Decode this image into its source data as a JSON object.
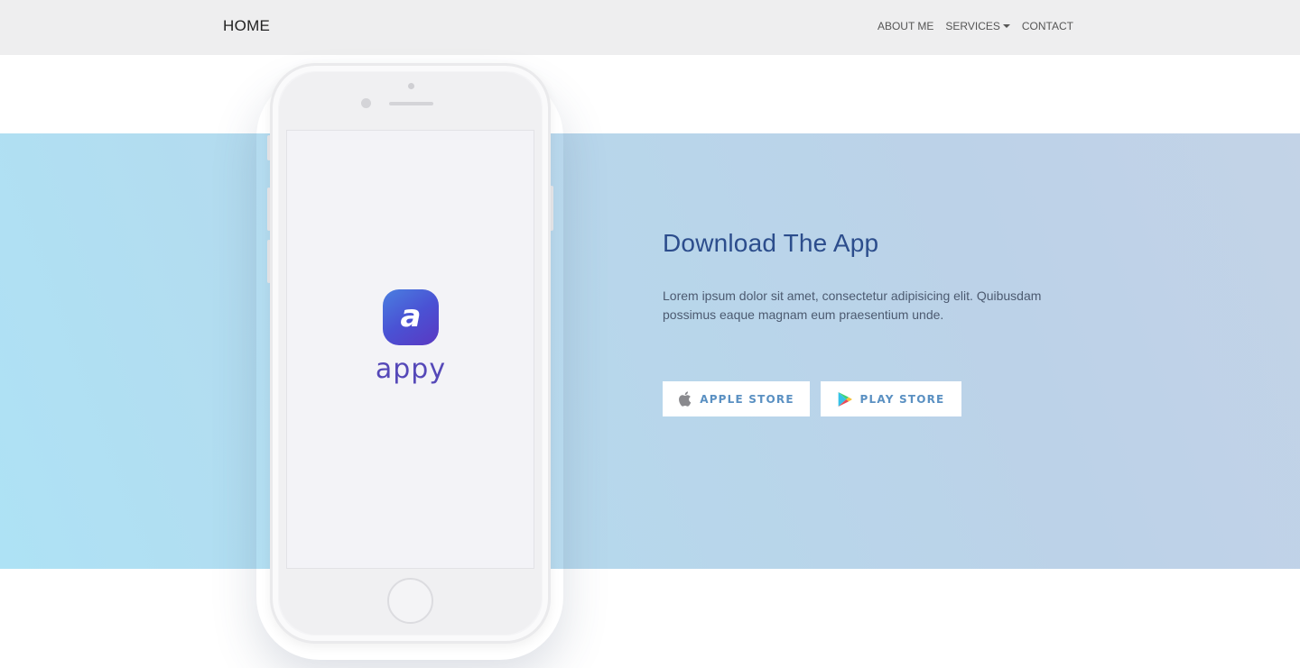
{
  "navbar": {
    "brand": "HOME",
    "links": [
      {
        "label": "ABOUT ME"
      },
      {
        "label": "SERVICES"
      },
      {
        "label": "CONTACT"
      }
    ]
  },
  "phone": {
    "app_icon_letter": "a",
    "app_name": "appy"
  },
  "hero": {
    "title": "Download The App",
    "description": "Lorem ipsum dolor sit amet, consectetur adipisicing elit. Quibusdam possimus eaque magnam eum praesentium unde.",
    "buttons": {
      "apple": {
        "label": "APPLE STORE",
        "icon": "apple-icon"
      },
      "play": {
        "label": "PLAY STORE",
        "icon": "play-store-icon"
      }
    }
  },
  "colors": {
    "accent_text": "#2c4d8c",
    "button_text": "#5a90c2",
    "app_icon": "#4a52d4",
    "hero_background": "#b6d8ec"
  }
}
